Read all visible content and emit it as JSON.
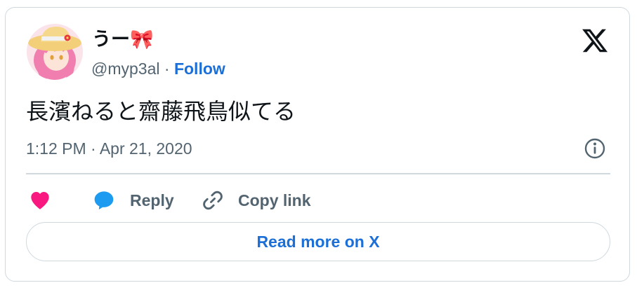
{
  "tweet": {
    "display_name": "うー🎀",
    "handle": "@myp3al",
    "separator": "·",
    "follow_label": "Follow",
    "text": "長濱ねると齋藤飛鳥似てる",
    "timestamp": "1:12 PM · Apr 21, 2020"
  },
  "actions": {
    "like_icon": "heart-icon",
    "reply_label": "Reply",
    "reply_icon": "speech-bubble-icon",
    "copy_label": "Copy link",
    "copy_icon": "link-icon"
  },
  "footer": {
    "read_more_label": "Read more on X"
  },
  "icons": {
    "brand": "x-logo-icon",
    "info": "info-icon"
  },
  "colors": {
    "like": "#f91880",
    "reply_icon": "#1d9bf0",
    "link_blue": "#1d6fd8",
    "muted_text": "#536471",
    "border": "#cfd9de"
  }
}
